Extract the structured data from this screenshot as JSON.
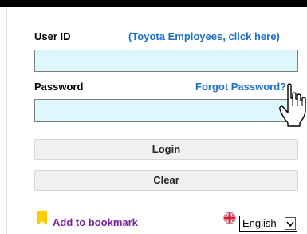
{
  "login_form": {
    "user_id_label": "User ID",
    "employee_link": "(Toyota Employees, click here)",
    "user_id_value": "",
    "password_label": "Password",
    "forgot_password_link": "Forgot Password?",
    "password_value": "",
    "login_button": "Login",
    "clear_button": "Clear"
  },
  "footer": {
    "bookmark_link": "Add to bookmark",
    "language_selected": "English"
  },
  "colors": {
    "input_background": "#ddf7fd",
    "link_blue": "#1f6fc5",
    "bookmark_purple": "#7b1fa2",
    "bookmark_icon_yellow": "#ffcc00",
    "button_background": "#f0f0f0"
  },
  "icons": {
    "bookmark": "bookmark-ribbon-icon",
    "flag": "uk-flag-icon",
    "language_dropdown": "chevron-down-icon",
    "mouse_cursor": "hand-pointer-icon"
  }
}
